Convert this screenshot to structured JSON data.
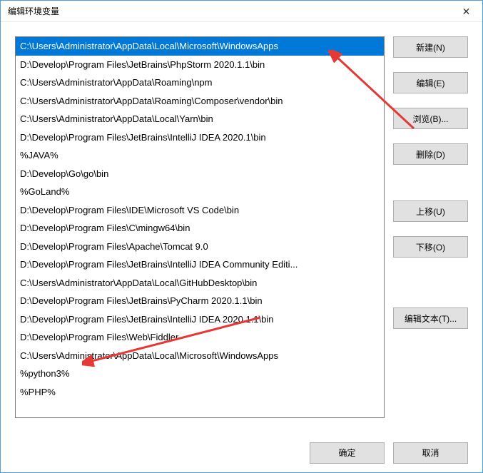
{
  "title": "编辑环境变量",
  "close_icon": "✕",
  "list": {
    "items": [
      "C:\\Users\\Administrator\\AppData\\Local\\Microsoft\\WindowsApps",
      "D:\\Develop\\Program Files\\JetBrains\\PhpStorm 2020.1.1\\bin",
      "C:\\Users\\Administrator\\AppData\\Roaming\\npm",
      "C:\\Users\\Administrator\\AppData\\Roaming\\Composer\\vendor\\bin",
      "C:\\Users\\Administrator\\AppData\\Local\\Yarn\\bin",
      "D:\\Develop\\Program Files\\JetBrains\\IntelliJ IDEA 2020.1\\bin",
      "%JAVA%",
      "D:\\Develop\\Go\\go\\bin",
      "%GoLand%",
      "D:\\Develop\\Program Files\\IDE\\Microsoft VS Code\\bin",
      "D:\\Develop\\Program Files\\C\\mingw64\\bin",
      "D:\\Develop\\Program Files\\Apache\\Tomcat 9.0",
      "D:\\Develop\\Program Files\\JetBrains\\IntelliJ IDEA Community Editi...",
      "C:\\Users\\Administrator\\AppData\\Local\\GitHubDesktop\\bin",
      "D:\\Develop\\Program Files\\JetBrains\\PyCharm 2020.1.1\\bin",
      "D:\\Develop\\Program Files\\JetBrains\\IntelliJ IDEA 2020.1.1\\bin",
      "D:\\Develop\\Program Files\\Web\\Fiddler",
      "C:\\Users\\Administrator\\AppData\\Local\\Microsoft\\WindowsApps",
      "%python3%",
      "%PHP%"
    ],
    "selected_index": 0
  },
  "buttons": {
    "new": "新建(N)",
    "edit": "编辑(E)",
    "browse": "浏览(B)...",
    "delete": "删除(D)",
    "move_up": "上移(U)",
    "move_down": "下移(O)",
    "edit_text": "编辑文本(T)..."
  },
  "footer": {
    "ok": "确定",
    "cancel": "取消"
  }
}
